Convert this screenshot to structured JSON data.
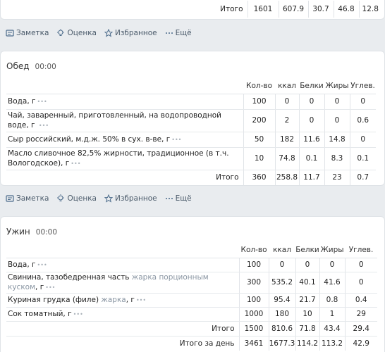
{
  "top_total": {
    "label": "Итого",
    "qty": "1601",
    "kcal": "607.9",
    "protein": "30.7",
    "fat": "46.8",
    "carbs": "12.8"
  },
  "actions": {
    "note": "Заметка",
    "rating": "Оценка",
    "favorites": "Избранное",
    "more": "Ещё"
  },
  "headers": {
    "qty": "Кол-во",
    "kcal": "ккал",
    "protein": "Белки",
    "fat": "Жиры",
    "carbs": "Углев."
  },
  "lunch": {
    "title": "Обед",
    "time": "00:00",
    "rows": [
      {
        "name": "Вода, г",
        "prep": "",
        "qty": "100",
        "kcal": "0",
        "protein": "0",
        "fat": "0",
        "carbs": "0"
      },
      {
        "name": "Чай, заваренный, приготовленный, на водопроводной воде, г",
        "prep": "",
        "qty": "200",
        "kcal": "2",
        "protein": "0",
        "fat": "0",
        "carbs": "0.6"
      },
      {
        "name": "Сыр российский, м.д.ж. 50% в сух. в-ве, г",
        "prep": "",
        "qty": "50",
        "kcal": "182",
        "protein": "11.6",
        "fat": "14.8",
        "carbs": "0"
      },
      {
        "name": "Масло сливочное 82,5% жирности, традиционное (в т.ч. Вологодское), г",
        "prep": "",
        "qty": "10",
        "kcal": "74.8",
        "protein": "0.1",
        "fat": "8.3",
        "carbs": "0.1"
      }
    ],
    "total": {
      "label": "Итого",
      "qty": "360",
      "kcal": "258.8",
      "protein": "11.7",
      "fat": "23",
      "carbs": "0.7"
    }
  },
  "dinner": {
    "title": "Ужин",
    "time": "00:00",
    "rows": [
      {
        "name": "Вода, г",
        "prep": "",
        "qty": "100",
        "kcal": "0",
        "protein": "0",
        "fat": "0",
        "carbs": "0"
      },
      {
        "name": "Свинина, тазобедренная часть",
        "prep": "жарка порционным куском",
        "suffix": ", г",
        "qty": "300",
        "kcal": "535.2",
        "protein": "40.1",
        "fat": "41.6",
        "carbs": "0"
      },
      {
        "name": "Куриная грудка (филе)",
        "prep": "жарка",
        "suffix": ", г",
        "qty": "100",
        "kcal": "95.4",
        "protein": "21.7",
        "fat": "0.8",
        "carbs": "0.4"
      },
      {
        "name": "Сок томатный, г",
        "prep": "",
        "qty": "1000",
        "kcal": "180",
        "protein": "10",
        "fat": "1",
        "carbs": "29"
      }
    ],
    "total": {
      "label": "Итого",
      "qty": "1500",
      "kcal": "810.6",
      "protein": "71.8",
      "fat": "43.4",
      "carbs": "29.4"
    },
    "day_total": {
      "label": "Итого за день",
      "qty": "3461",
      "kcal": "1677.3",
      "protein": "114.2",
      "fat": "113.2",
      "carbs": "42.9"
    }
  },
  "icons": {
    "note": "note-icon",
    "rating": "bulb-icon",
    "favorites": "star-icon",
    "more": "ellipsis-icon",
    "options": "dots-icon"
  },
  "colors": {
    "prep_text": "#8a96a3",
    "page_bg": "#e9ecef",
    "card_bg": "#ffffff"
  }
}
